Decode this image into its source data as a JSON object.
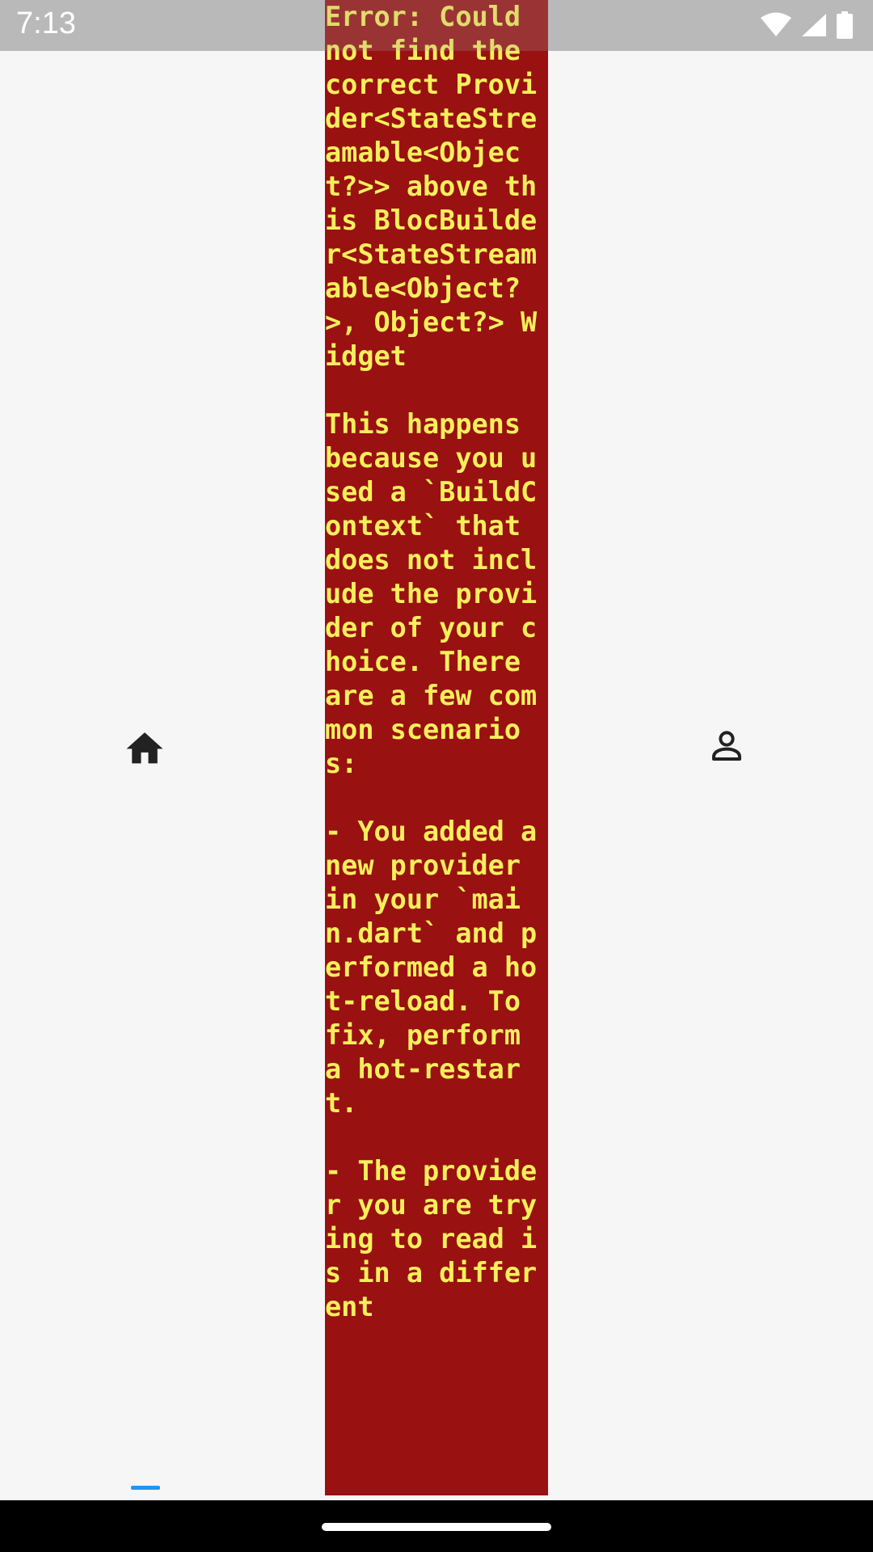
{
  "status_bar": {
    "time": "7:13",
    "icons": [
      "wifi-icon",
      "signal-icon",
      "battery-icon"
    ]
  },
  "error": {
    "message": "Error: Could not find the correct Provider<StateStreamable<Object?>> above this BlocBuilder<StateStreamable<Object?>, Object?> Widget\n\nThis happens because you used a `BuildContext` that does not include the provider of your choice. There are a few common scenarios:\n\n- You added a new provider in your `main.dart` and performed a hot-reload. To fix, perform a hot-restart.\n\n- The provider you are trying to read is in a different"
  },
  "nav": {
    "items": [
      {
        "icon": "home-icon",
        "selected": true
      },
      {
        "icon": "person-icon",
        "selected": false
      }
    ]
  },
  "colors": {
    "error_background": "#991111",
    "error_text": "#f7ef5c",
    "accent": "#2196f3"
  }
}
